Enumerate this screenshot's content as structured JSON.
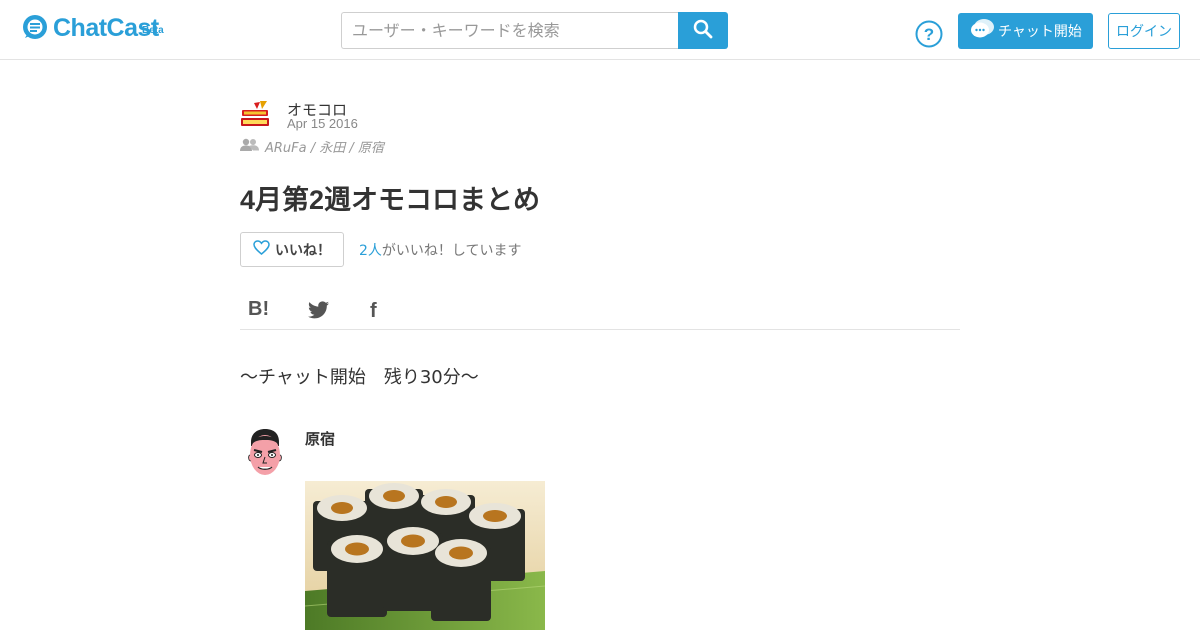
{
  "header": {
    "logo_text": "ChatCast",
    "logo_badge": "Beta",
    "search_placeholder": "ユーザー・キーワードを検索",
    "search_icon": "search-icon",
    "help_icon": "question-circle-icon",
    "chat_button_label": "チャット開始",
    "chat_button_icon": "chat-bubble-icon",
    "login_button_label": "ログイン",
    "accent_color": "#2a9fd8"
  },
  "author": {
    "name": "オモコロ",
    "date": "Apr 15 2016",
    "members_icon": "users-icon",
    "members": "ARuFa / 永田 / 原宿"
  },
  "article": {
    "title": "4月第2週オモコロまとめ"
  },
  "like": {
    "button_label": "いいね！",
    "icon": "heart-outline-icon",
    "count": "2人",
    "suffix": "がいいね！しています"
  },
  "share": {
    "hatena_label": "B!",
    "twitter_icon": "twitter-icon",
    "facebook_label": "f"
  },
  "chat": {
    "system_message": "～チャット開始　残り30分～",
    "messages": [
      {
        "speaker": "原宿",
        "avatar": "caricature-avatar",
        "attachment": "sushi-roll-photo"
      }
    ]
  }
}
